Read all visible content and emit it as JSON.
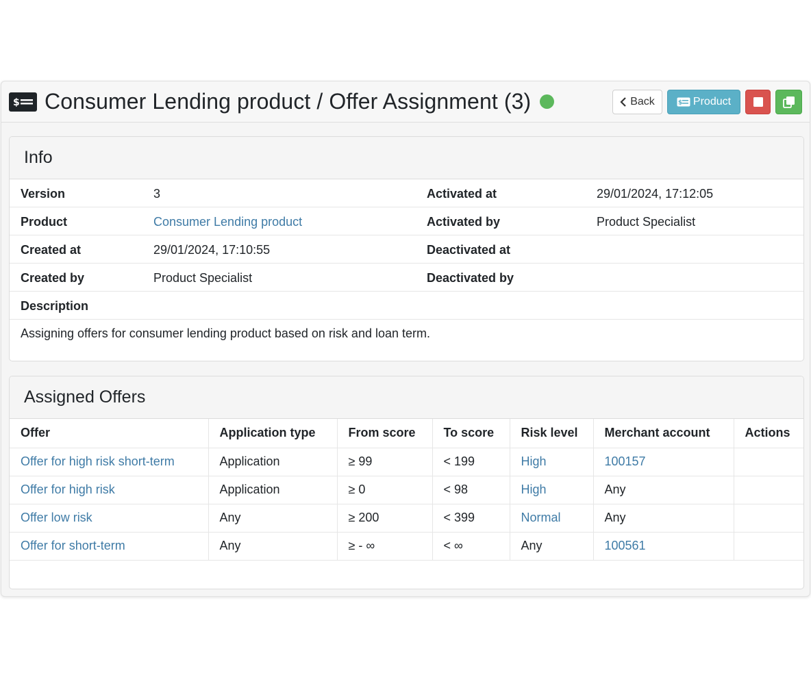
{
  "header": {
    "title": "Consumer Lending product / Offer Assignment (3)",
    "status_color": "#5cb85c",
    "icon": "product-card-icon",
    "back_label": "Back",
    "product_label": "Product",
    "stop_icon": "stop-icon",
    "copy_icon": "copy-icon"
  },
  "info": {
    "heading": "Info",
    "rows": [
      {
        "l1": "Version",
        "v1": "3",
        "l2": "Activated at",
        "v2": "29/01/2024, 17:12:05"
      },
      {
        "l1": "Product",
        "v1": "Consumer Lending product",
        "l2": "Activated by",
        "v2": "Product Specialist"
      },
      {
        "l1": "Created at",
        "v1": "29/01/2024, 17:10:55",
        "l2": "Deactivated at",
        "v2": ""
      },
      {
        "l1": "Created by",
        "v1": "Product Specialist",
        "l2": "Deactivated by",
        "v2": ""
      }
    ],
    "description_label": "Description",
    "description": "Assigning offers for consumer lending product based on risk and loan term."
  },
  "offers": {
    "heading": "Assigned Offers",
    "columns": [
      "Offer",
      "Application type",
      "From score",
      "To score",
      "Risk level",
      "Merchant account",
      "Actions"
    ],
    "rows": [
      {
        "offer": "Offer for high risk short-term",
        "app_type": "Application",
        "from": "≥ 99",
        "to": "< 199",
        "risk": "High",
        "merchant": "100157",
        "actions": ""
      },
      {
        "offer": "Offer for high risk",
        "app_type": "Application",
        "from": "≥ 0",
        "to": "< 98",
        "risk": "High",
        "merchant": "Any",
        "actions": ""
      },
      {
        "offer": "Offer low risk",
        "app_type": "Any",
        "from": "≥ 200",
        "to": "< 399",
        "risk": "Normal",
        "merchant": "Any",
        "actions": ""
      },
      {
        "offer": "Offer for short-term",
        "app_type": "Any",
        "from": "≥ - ∞",
        "to": "< ∞",
        "risk": "Any",
        "merchant": "100561",
        "actions": ""
      }
    ]
  },
  "colors": {
    "link": "#3f7ba6",
    "info_button": "#5bb0c7",
    "danger_button": "#d9534f",
    "success_button": "#5cb85c"
  }
}
